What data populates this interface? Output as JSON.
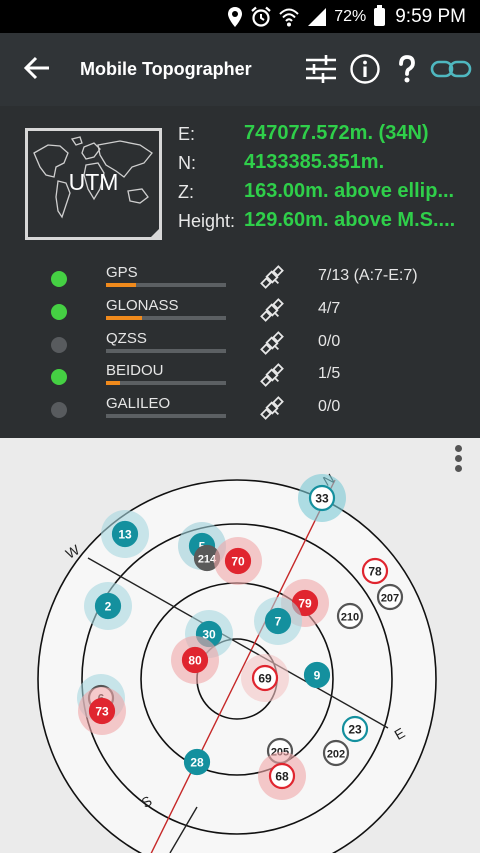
{
  "status_bar": {
    "battery": "72%",
    "time": "9:59 PM",
    "icons": [
      "location-icon",
      "alarm-icon",
      "wifi-icon",
      "signal-icon",
      "battery-icon"
    ]
  },
  "app_bar": {
    "title": "Mobile Topographer",
    "actions": [
      "settings-sliders-icon",
      "info-icon",
      "help-icon",
      "connect-link-icon"
    ]
  },
  "coordinates": {
    "system": "UTM",
    "rows": [
      {
        "key": "E:",
        "value": "747077.572m. (34N)"
      },
      {
        "key": "N:",
        "value": "4133385.351m."
      },
      {
        "key": "Z:",
        "value": "163.00m. above ellip..."
      },
      {
        "key": "Height:",
        "value": "129.60m. above M.S...."
      }
    ]
  },
  "constellations": [
    {
      "name": "GPS",
      "status": "active",
      "status_color": "#45d043",
      "signal": 0.25,
      "count": "7/13 (A:7-E:7)"
    },
    {
      "name": "GLONASS",
      "status": "active",
      "status_color": "#45d043",
      "signal": 0.3,
      "count": "4/7"
    },
    {
      "name": "QZSS",
      "status": "inactive",
      "status_color": "#585b5e",
      "signal": 0,
      "count": "0/0"
    },
    {
      "name": "BEIDOU",
      "status": "active",
      "status_color": "#45d043",
      "signal": 0.12,
      "count": "1/5"
    },
    {
      "name": "GALILEO",
      "status": "inactive",
      "status_color": "#585b5e",
      "signal": 0,
      "count": "0/0"
    }
  ],
  "skyplot": {
    "directions": [
      "N",
      "E",
      "S",
      "W"
    ],
    "satellites": [
      {
        "id": "33",
        "style": "ring-teal"
      },
      {
        "id": "13",
        "style": "teal"
      },
      {
        "id": "5",
        "style": "teal"
      },
      {
        "id": "214",
        "style": "gray"
      },
      {
        "id": "70",
        "style": "red"
      },
      {
        "id": "78",
        "style": "ring-red"
      },
      {
        "id": "207",
        "style": "ring-gray"
      },
      {
        "id": "2",
        "style": "teal"
      },
      {
        "id": "79",
        "style": "red"
      },
      {
        "id": "210",
        "style": "ring-gray"
      },
      {
        "id": "30",
        "style": "teal"
      },
      {
        "id": "7",
        "style": "teal"
      },
      {
        "id": "80",
        "style": "red"
      },
      {
        "id": "69",
        "style": "ring-red"
      },
      {
        "id": "9",
        "style": "teal"
      },
      {
        "id": "6",
        "style": "ring-gray"
      },
      {
        "id": "73",
        "style": "red"
      },
      {
        "id": "23",
        "style": "ring-teal"
      },
      {
        "id": "205",
        "style": "ring-gray"
      },
      {
        "id": "202",
        "style": "ring-gray"
      },
      {
        "id": "28",
        "style": "teal"
      },
      {
        "id": "68",
        "style": "ring-red"
      }
    ],
    "colors": {
      "teal": "#14909e",
      "red": "#e0252f",
      "gray": "#5a5a5a"
    }
  }
}
